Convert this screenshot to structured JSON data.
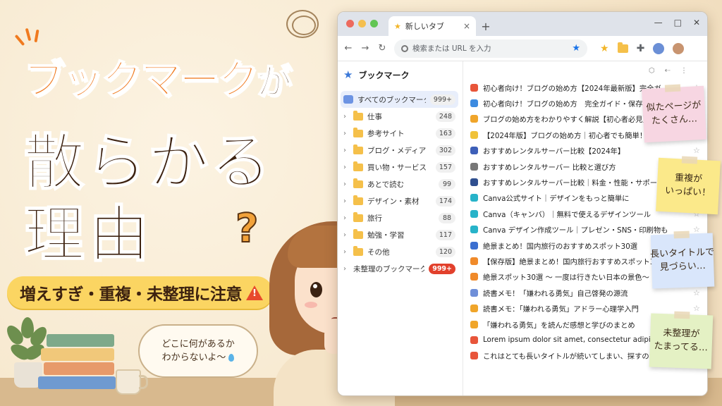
{
  "title": {
    "line1_main": "ブックマーク",
    "line1_suffix": "が",
    "line2": "散らかる",
    "line3": "理由"
  },
  "subtitle": "増えすぎ・重複・未整理に注意",
  "speech_bubble": {
    "line1": "どこに何があるか",
    "line2": "わからないよ〜"
  },
  "question_mark": "?",
  "browser": {
    "tab_title": "新しいタブ",
    "new_tab": "+",
    "window_controls": [
      "—",
      "□",
      "✕"
    ],
    "omnibox_placeholder": "検索または URL を入力",
    "sidebar": {
      "header": "ブックマーク",
      "items": [
        {
          "label": "すべてのブックマーク",
          "count": "999+",
          "type": "all"
        },
        {
          "label": "仕事",
          "count": "248",
          "type": "folder"
        },
        {
          "label": "参考サイト",
          "count": "163",
          "type": "folder"
        },
        {
          "label": "ブログ・メディア",
          "count": "302",
          "type": "folder"
        },
        {
          "label": "買い物・サービス",
          "count": "157",
          "type": "folder"
        },
        {
          "label": "あとで読む",
          "count": "99",
          "type": "folder"
        },
        {
          "label": "デザイン・素材",
          "count": "174",
          "type": "folder"
        },
        {
          "label": "旅行",
          "count": "88",
          "type": "folder"
        },
        {
          "label": "勉強・学習",
          "count": "117",
          "type": "folder"
        },
        {
          "label": "その他",
          "count": "120",
          "type": "folder"
        },
        {
          "label": "未整理のブックマーク",
          "count": "999+",
          "type": "unsorted"
        }
      ]
    },
    "bookmarks": [
      {
        "title": "初心者向け！ブログの始め方【2024年最新版】完全ガ…",
        "color": "#e8553a"
      },
      {
        "title": "初心者向け！ブログの始め方　完全ガイド・保存版",
        "color": "#3d8be0"
      },
      {
        "title": "ブログの始め方をわかりやすく解説【初心者必見】",
        "color": "#f0a52a"
      },
      {
        "title": "【2024年版】ブログの始め方｜初心者でも簡単！",
        "color": "#f0c23a"
      },
      {
        "title": "おすすめレンタルサーバー比較【2024年】",
        "color": "#3d5fb8"
      },
      {
        "title": "おすすめレンタルサーバー 比較と選び方",
        "color": "#777777"
      },
      {
        "title": "おすすめレンタルサーバー比較｜料金・性能・サポー…",
        "color": "#2f4f8f"
      },
      {
        "title": "Canva公式サイト｜デザインをもっと簡単に",
        "color": "#27b3c9"
      },
      {
        "title": "Canva（キャンバ）｜無料で使えるデザインツール",
        "color": "#27b3c9"
      },
      {
        "title": "Canva デザイン作成ツール｜プレゼン・SNS・印刷物も",
        "color": "#27b3c9"
      },
      {
        "title": "絶景まとめ！国内旅行のおすすめスポット30選",
        "color": "#3b6fd0"
      },
      {
        "title": "【保存版】絶景まとめ！国内旅行おすすめスポット30…",
        "color": "#f08a2a"
      },
      {
        "title": "絶景スポット30選 〜 一度は行きたい日本の景色〜",
        "color": "#f08a2a"
      },
      {
        "title": "読書メモ！「嫌われる勇気」自己啓発の源流",
        "color": "#6f8fd8"
      },
      {
        "title": "読書メモ：「嫌われる勇気」アドラー心理学入門",
        "color": "#f0a52a"
      },
      {
        "title": "「嫌われる勇気」を読んだ感想と学びのまとめ",
        "color": "#f0a52a"
      },
      {
        "title": "Lorem ipsum dolor sit amet, consectetur adipis…",
        "color": "#e8553a"
      },
      {
        "title": "これはとても長いタイトルが続いてしまい、探すのが大変",
        "color": "#e8553a"
      }
    ]
  },
  "sticky_notes": [
    {
      "line1": "似たページが",
      "line2": "たくさん…",
      "color": "#f7d6e2"
    },
    {
      "line1": "重複が",
      "line2": "いっぱい！",
      "color": "#fbe98a"
    },
    {
      "line1": "長いタイトルで",
      "line2": "見づらい…",
      "color": "#d9e6fb"
    },
    {
      "line1": "未整理が",
      "line2": "たまってる…",
      "color": "#e4f1c4"
    }
  ],
  "colors": {
    "accent_orange": "#f07a1f",
    "title_brown": "#3d2210",
    "subtitle_yellow": "#fbd562",
    "badge_red": "#e2402c"
  },
  "icons": [
    "warning-icon",
    "star-icon",
    "folder-icon",
    "search-icon",
    "extension-icon",
    "profile-icon",
    "water-drop-icon"
  ]
}
